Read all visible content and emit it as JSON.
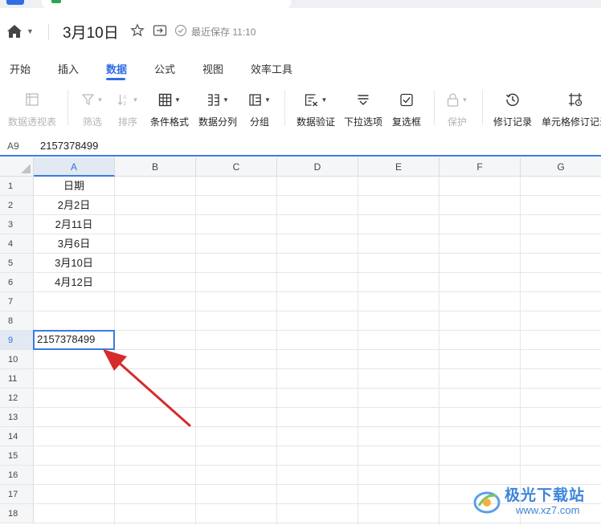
{
  "document": {
    "title": "3月10日",
    "save_status": "最近保存 11:10"
  },
  "ribbon_tabs": [
    {
      "label": "开始",
      "active": false
    },
    {
      "label": "插入",
      "active": false
    },
    {
      "label": "数据",
      "active": true
    },
    {
      "label": "公式",
      "active": false
    },
    {
      "label": "视图",
      "active": false
    },
    {
      "label": "效率工具",
      "active": false
    }
  ],
  "toolbar": {
    "pivot": "数据透视表",
    "filter": "筛选",
    "sort": "排序",
    "conditional_format": "条件格式",
    "split_columns": "数据分列",
    "group": "分组",
    "data_validation": "数据验证",
    "dropdown": "下拉选项",
    "checkbox": "复选框",
    "protect": "保护",
    "revision_history": "修订记录",
    "cell_revision": "单元格修订记录"
  },
  "formula_bar": {
    "cell_ref": "A9",
    "value": "2157378499"
  },
  "sheet": {
    "columns": [
      "A",
      "B",
      "C",
      "D",
      "E",
      "F",
      "G"
    ],
    "rows": [
      "1",
      "2",
      "3",
      "4",
      "5",
      "6",
      "7",
      "8",
      "9",
      "10",
      "11",
      "12",
      "13",
      "14",
      "15",
      "16",
      "17",
      "18"
    ],
    "cells": {
      "A1": "日期",
      "A2": "2月2日",
      "A3": "2月11日",
      "A4": "3月6日",
      "A5": "3月10日",
      "A6": "4月12日",
      "A9": "2157378499"
    },
    "header_font_button": "A",
    "selected_cell": "A9"
  },
  "watermark": {
    "brand": "极光下载站",
    "url": "www.xz7.com"
  },
  "colors": {
    "accent": "#2f6ee6",
    "selection": "#3a7be0",
    "arrow": "#d62b2b"
  }
}
